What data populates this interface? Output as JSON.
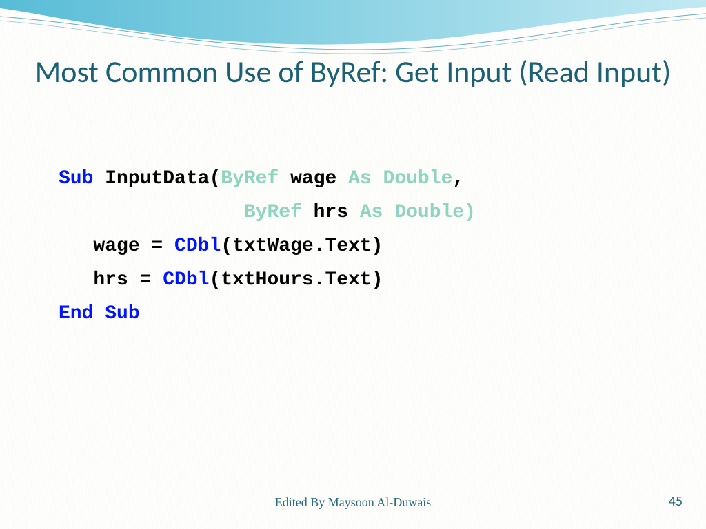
{
  "title": "Most Common Use of ByRef: Get Input (Read Input)",
  "code": {
    "l1": {
      "sub": "Sub",
      "name": " InputData(",
      "byref1": "ByRef",
      "wage": " wage ",
      "as1": "As Double",
      "comma": ","
    },
    "l2": {
      "pad": "                ",
      "byref2": "ByRef",
      "hrs": " hrs ",
      "as2": "As Double)"
    },
    "l3": {
      "indent": "   wage = ",
      "cdbl": "CDbl",
      "rest": "(txtWage.Text)"
    },
    "l4": {
      "indent": "   hrs = ",
      "cdbl": "CDbl",
      "rest": "(txtHours.Text)"
    },
    "l5": {
      "endsub": "End Sub"
    }
  },
  "footer": "Edited By Maysoon Al-Duwais",
  "page": "45"
}
